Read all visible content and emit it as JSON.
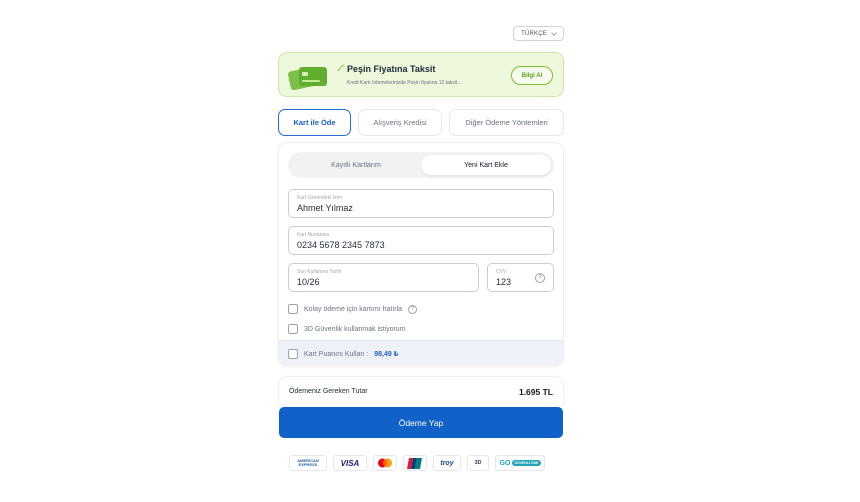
{
  "language": {
    "label": "TÜRKÇE"
  },
  "promo": {
    "title": "Peşin Fiyatına Taksit",
    "description": "Kredi Kartı ödemelerinizde Peşin fiyatına 12 taksit...",
    "button": "Bilgi Al"
  },
  "payment_tabs": [
    {
      "label": "Kart ile Öde",
      "active": true
    },
    {
      "label": "Alışveriş Kredisi",
      "active": false
    },
    {
      "label": "Diğer Ödeme Yöntemleri",
      "active": false
    }
  ],
  "card_tabs": [
    {
      "label": "Kayıtlı Kartlarım",
      "active": false
    },
    {
      "label": "Yeni Kart Ekle",
      "active": true
    }
  ],
  "form": {
    "name": {
      "label": "Kart Üzerindeki İsim",
      "value": "Ahmet Yılmaz"
    },
    "number": {
      "label": "Kart Numarası",
      "value": "0234 5678 2345 7873"
    },
    "expiry": {
      "label": "Son Kullanma Tarihi",
      "value": "10/26"
    },
    "cvv": {
      "label": "CVV",
      "value": "123",
      "help": "?"
    },
    "remember": {
      "label": "Kolay ödeme için kartımı hatırla",
      "checked": false,
      "help": "?"
    },
    "secure3d": {
      "label": "3D Güvenlik kullanmak istiyorum",
      "checked": false
    },
    "points": {
      "label": "Kart Puanını Kullan :",
      "amount": "98,49 ₺",
      "checked": false
    }
  },
  "total": {
    "label": "Ödemeniz Gereken Tutar",
    "value": "1.695 TL"
  },
  "pay_button": "Ödeme Yap",
  "logos": {
    "amex": "AMERICAN EXPRESS",
    "visa": "VISA",
    "troy": "troy",
    "secure3d": "3D",
    "secure": "GÜVENLİ ÖDE"
  },
  "colors": {
    "primary": "#1061c8",
    "promo_bg": "#eef8dc",
    "promo_accent": "#7cbf2a"
  }
}
